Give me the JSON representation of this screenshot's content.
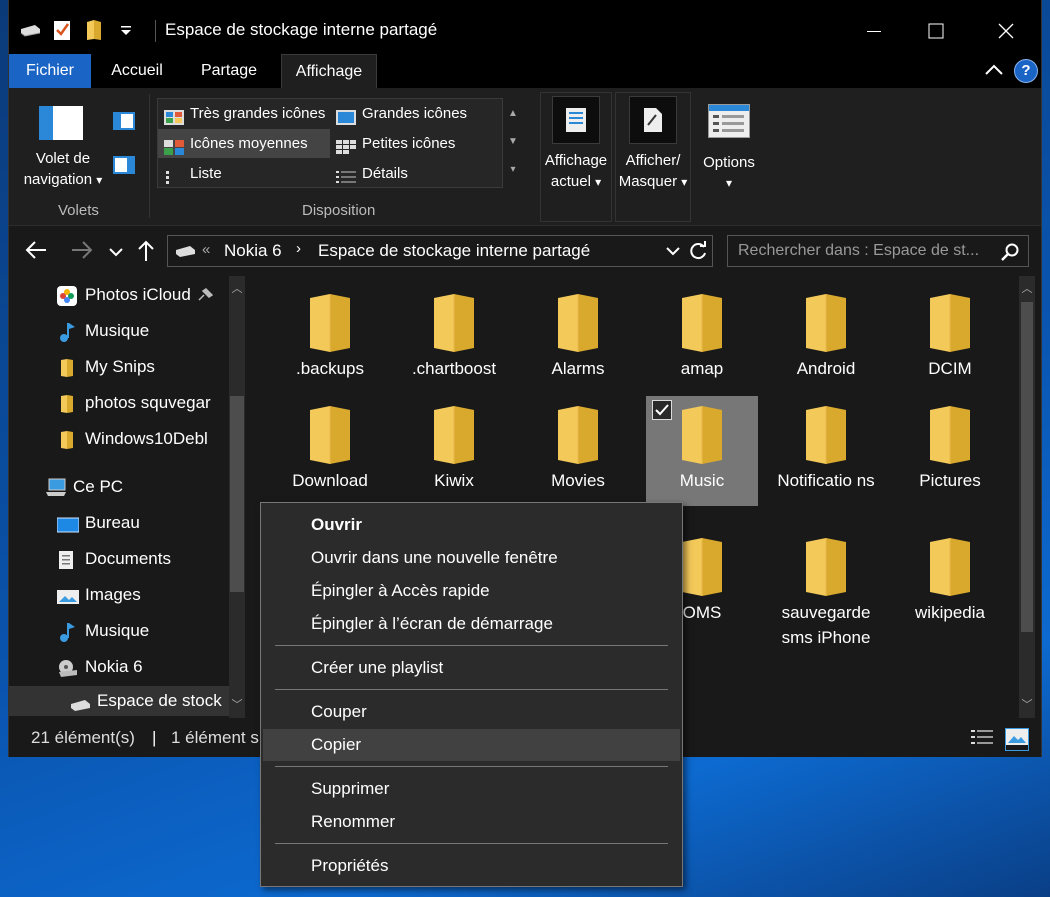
{
  "window": {
    "title": "Espace de stockage interne partagé",
    "qat_icons": [
      "drive-icon",
      "properties-icon",
      "new-folder-icon",
      "customize-qat-icon"
    ]
  },
  "ribbon": {
    "tabs": [
      "Fichier",
      "Accueil",
      "Partage",
      "Affichage"
    ],
    "active_tab": "Affichage",
    "volets": {
      "nav_label_line1": "Volet de",
      "nav_label_line2": "navigation",
      "group_label": "Volets"
    },
    "disposition": {
      "group_label": "Disposition",
      "options": [
        "Très grandes icônes",
        "Grandes icônes",
        "Icônes moyennes",
        "Petites icônes",
        "Liste",
        "Détails"
      ],
      "selected": "Icônes moyennes"
    },
    "current_view": {
      "line1": "Affichage",
      "line2": "actuel"
    },
    "show_hide": {
      "line1": "Afficher/",
      "line2": "Masquer"
    },
    "options": {
      "label": "Options"
    }
  },
  "navbar": {
    "breadcrumb": [
      "Nokia 6",
      "Espace de stockage interne partagé"
    ],
    "search_placeholder": "Rechercher dans : Espace de st..."
  },
  "navpane": {
    "items": [
      {
        "label": "Photos iCloud",
        "icon": "photos-icon"
      },
      {
        "label": "Musique",
        "icon": "music-icon"
      },
      {
        "label": "My Snips",
        "icon": "folder-icon"
      },
      {
        "label": "photos squvegar",
        "icon": "folder-icon"
      },
      {
        "label": "Windows10Debl",
        "icon": "folder-icon"
      },
      {
        "label": "Ce PC",
        "icon": "computer-icon"
      },
      {
        "label": "Bureau",
        "icon": "desktop-icon"
      },
      {
        "label": "Documents",
        "icon": "documents-icon"
      },
      {
        "label": "Images",
        "icon": "pictures-icon"
      },
      {
        "label": "Musique",
        "icon": "music-icon"
      },
      {
        "label": "Nokia 6",
        "icon": "device-icon"
      },
      {
        "label": "Espace de stock",
        "icon": "drive-icon"
      }
    ]
  },
  "content": {
    "folders": [
      ".backups",
      ".chartboost",
      "Alarms",
      "amap",
      "Android",
      "DCIM",
      "Download",
      "Kiwix",
      "Movies",
      "Music",
      "Notificatio ns",
      "Pictures",
      "OMS",
      "sauvegarde sms iPhone",
      "wikipedia"
    ],
    "selected": "Music",
    "colors": {
      "folder": "#f3c95a",
      "folder_dark": "#d9a92d",
      "selection": "#777777"
    }
  },
  "status": {
    "count": "21 élément(s)",
    "selection": "1 élément s"
  },
  "context_menu": {
    "items": [
      {
        "label": "Ouvrir",
        "bold": true
      },
      {
        "label": "Ouvrir dans une nouvelle fenêtre"
      },
      {
        "label": "Épingler à Accès rapide"
      },
      {
        "label": "Épingler à l’écran de démarrage"
      },
      {
        "label": "Créer une playlist"
      },
      {
        "label": "Couper"
      },
      {
        "label": "Copier",
        "hover": true
      },
      {
        "label": "Supprimer"
      },
      {
        "label": "Renommer"
      },
      {
        "label": "Propriétés"
      }
    ]
  }
}
